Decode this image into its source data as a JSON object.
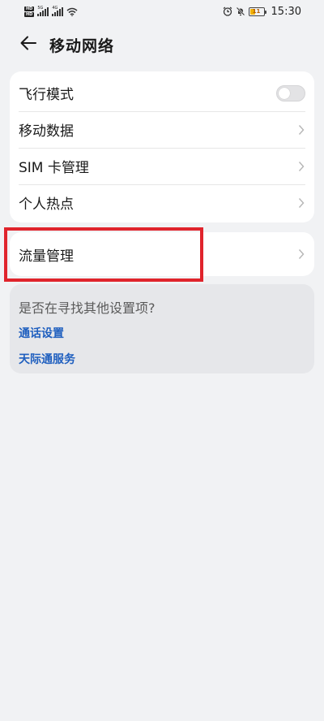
{
  "status_bar": {
    "left_chips": [
      "HD",
      "HD"
    ],
    "signal_tags": [
      "5G",
      "4G"
    ],
    "time": "15:30",
    "battery_level": "11",
    "icons": [
      "alarm-icon",
      "mute-icon",
      "battery-icon",
      "wifi-icon"
    ]
  },
  "header": {
    "title": "移动网络",
    "back_icon": "arrow-left-icon"
  },
  "settings": {
    "items": [
      {
        "label": "飞行模式",
        "control": "toggle",
        "on": false
      },
      {
        "label": "移动数据",
        "control": "chevron"
      },
      {
        "label": "SIM 卡管理",
        "control": "chevron"
      },
      {
        "label": "个人热点",
        "control": "chevron"
      }
    ],
    "traffic": {
      "label": "流量管理",
      "control": "chevron"
    }
  },
  "suggestions": {
    "title": "是否在寻找其他设置项?",
    "links": [
      "通话设置",
      "天际通服务"
    ]
  },
  "colors": {
    "background": "#f1f2f4",
    "card": "#ffffff",
    "link": "#1f5fbf",
    "highlight": "#e0242c"
  }
}
